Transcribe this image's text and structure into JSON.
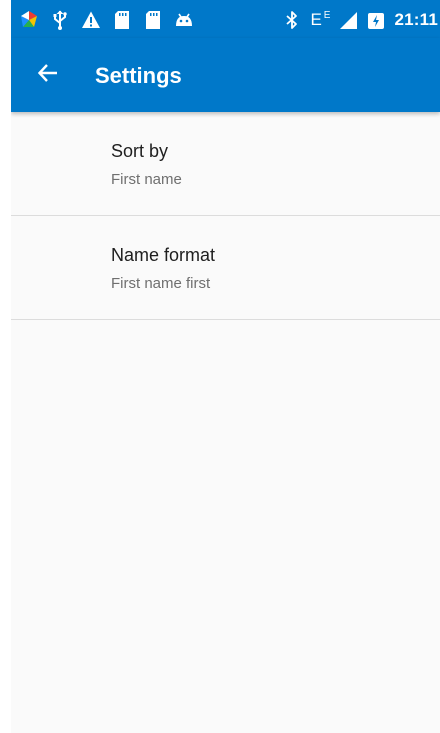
{
  "status_bar": {
    "network_label": "E",
    "network_superscript": "E",
    "time": "21:11",
    "icons": [
      "app-icon",
      "usb-icon",
      "warning-icon",
      "sd-card-icon",
      "sd-card-icon",
      "android-icon",
      "bluetooth-icon",
      "signal-icon",
      "battery-icon"
    ]
  },
  "app_bar": {
    "title": "Settings",
    "back_icon": "arrow-left-icon",
    "color": "#0078c9"
  },
  "settings": [
    {
      "title": "Sort by",
      "summary": "First name"
    },
    {
      "title": "Name format",
      "summary": "First name first"
    }
  ],
  "colors": {
    "primary": "#0078c9",
    "background": "#fafafa",
    "divider": "#dcdcdc",
    "title_text": "#202020",
    "summary_text": "#6f6f6f"
  }
}
